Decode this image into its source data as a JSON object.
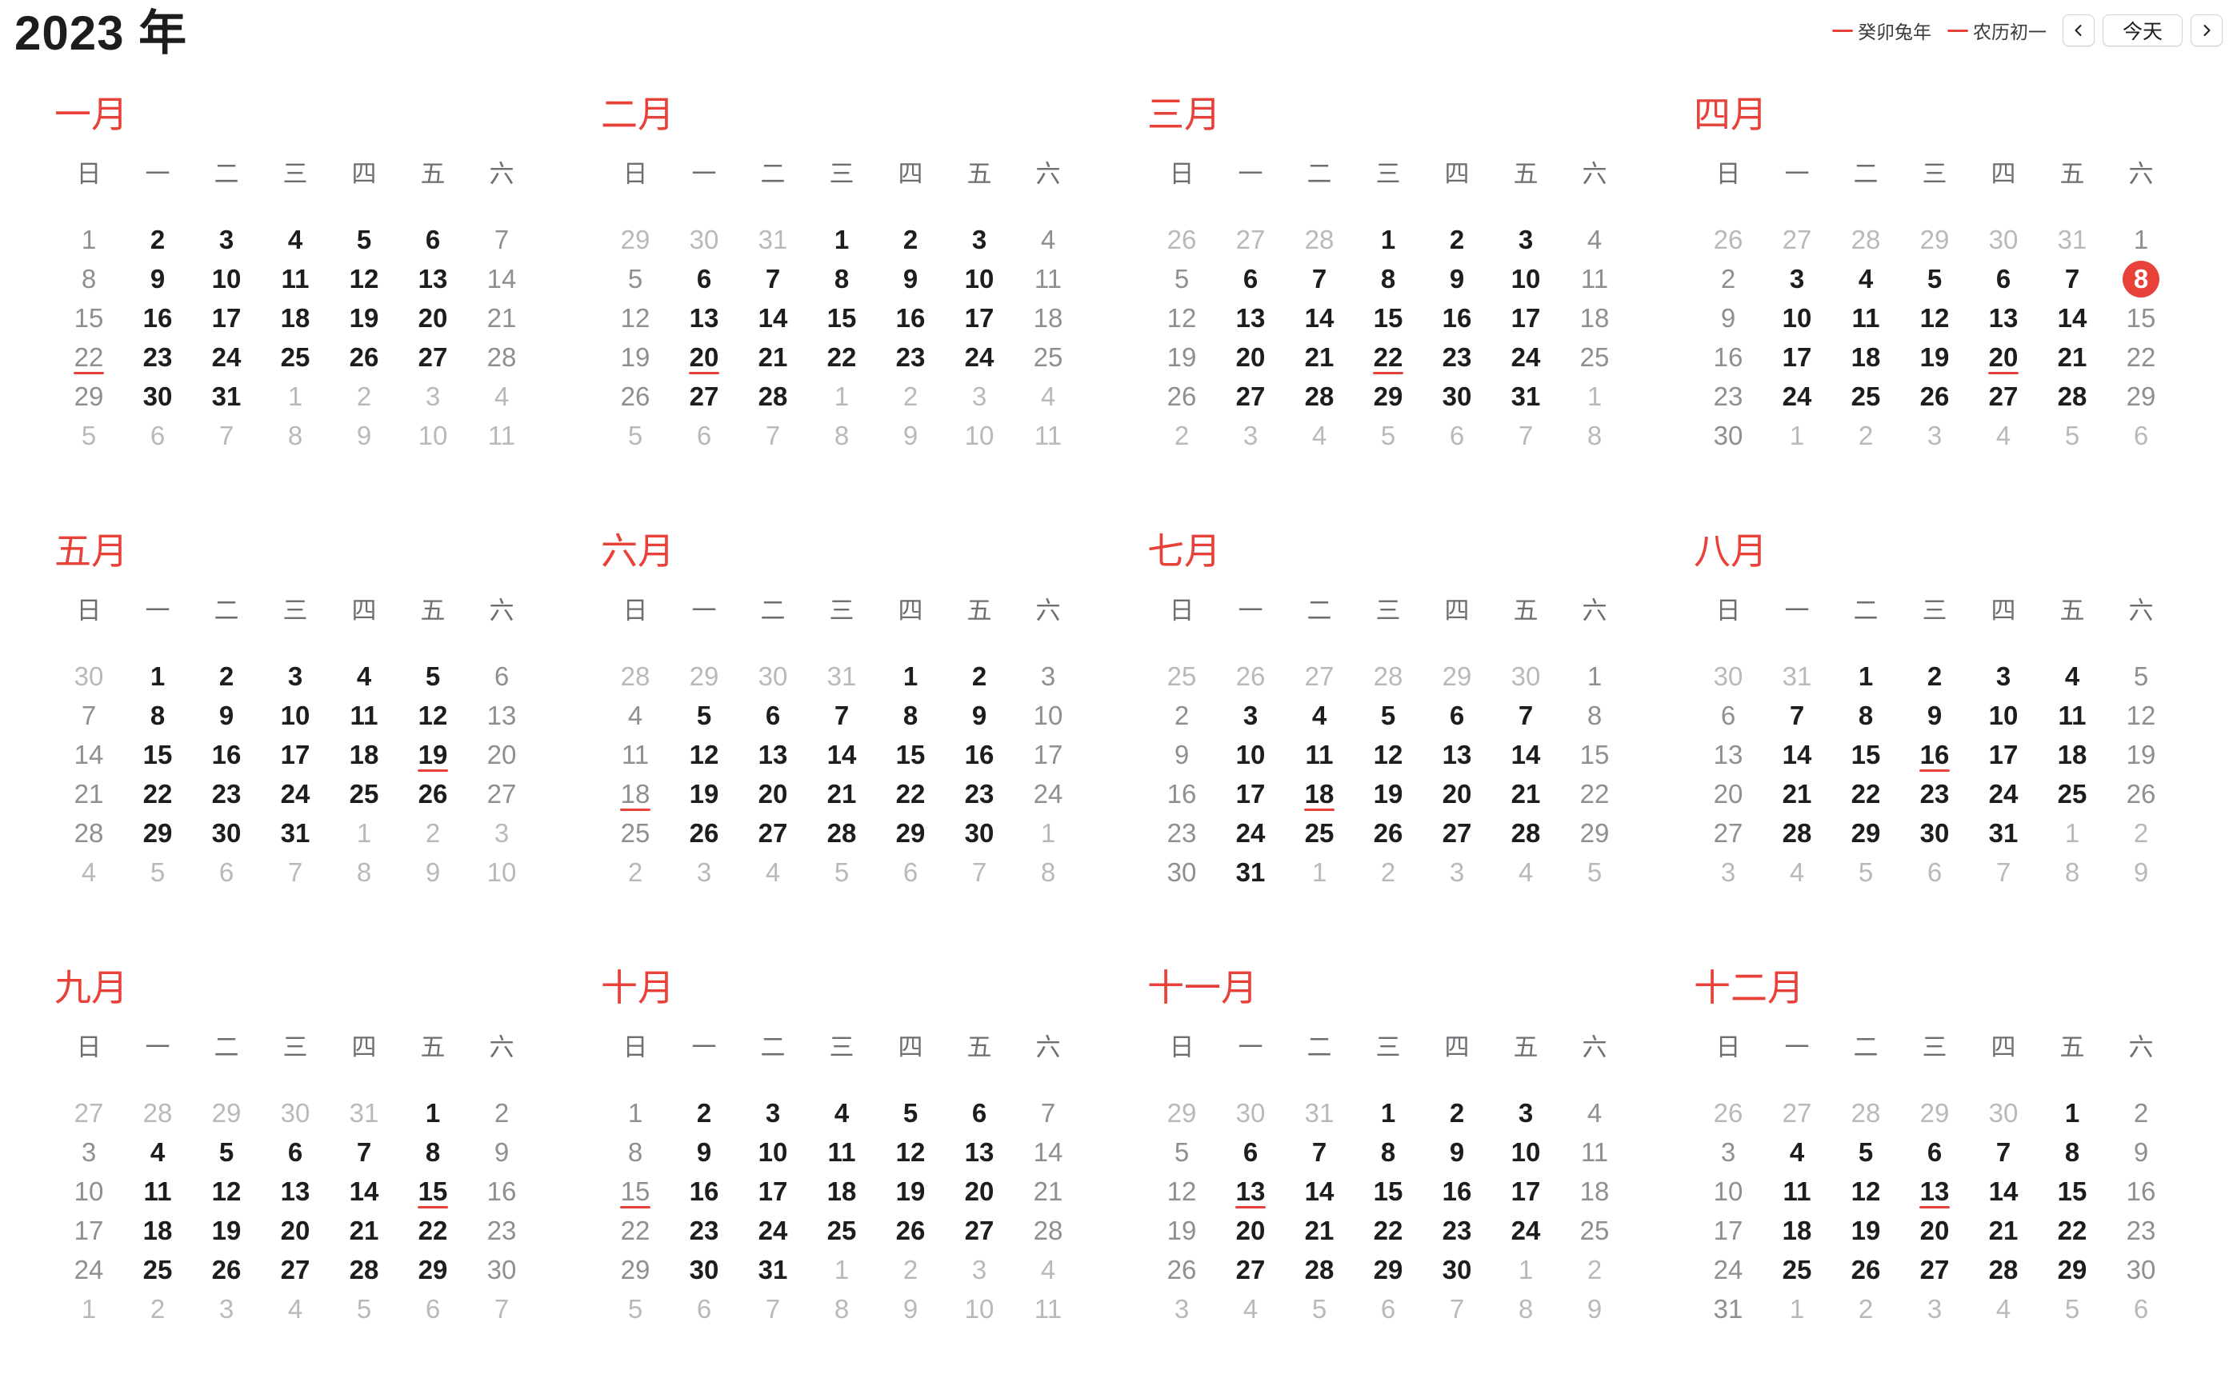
{
  "year_title": "2023 年",
  "legend": [
    {
      "label": "癸卯兔年",
      "color": "#e8413a"
    },
    {
      "label": "农历初一",
      "color": "#e8413a"
    }
  ],
  "nav": {
    "prev_icon": "chevron-left-icon",
    "today_label": "今天",
    "next_icon": "chevron-right-icon"
  },
  "weekdays": [
    "日",
    "一",
    "二",
    "三",
    "四",
    "五",
    "六"
  ],
  "today": {
    "month": 4,
    "day": 8
  },
  "accent_color": "#e8413a",
  "months": [
    {
      "name": "一月",
      "lead": [],
      "days": 31,
      "trail": [
        1,
        2,
        3,
        4,
        5,
        6,
        7,
        8,
        9,
        10,
        11
      ],
      "holidays": [
        22
      ]
    },
    {
      "name": "二月",
      "lead": [
        29,
        30,
        31
      ],
      "days": 28,
      "trail": [
        1,
        2,
        3,
        4,
        5,
        6,
        7,
        8,
        9,
        10,
        11
      ],
      "holidays": [
        20
      ]
    },
    {
      "name": "三月",
      "lead": [
        26,
        27,
        28
      ],
      "days": 31,
      "trail": [
        1,
        2,
        3,
        4,
        5,
        6,
        7,
        8
      ],
      "holidays": [
        22
      ]
    },
    {
      "name": "四月",
      "lead": [
        26,
        27,
        28,
        29,
        30,
        31
      ],
      "days": 30,
      "trail": [
        1,
        2,
        3,
        4,
        5,
        6
      ],
      "holidays": [
        20
      ]
    },
    {
      "name": "五月",
      "lead": [
        30
      ],
      "days": 31,
      "trail": [
        1,
        2,
        3,
        4,
        5,
        6,
        7,
        8,
        9,
        10
      ],
      "holidays": [
        19
      ]
    },
    {
      "name": "六月",
      "lead": [
        28,
        29,
        30,
        31
      ],
      "days": 30,
      "trail": [
        1,
        2,
        3,
        4,
        5,
        6,
        7,
        8
      ],
      "holidays": [
        18
      ]
    },
    {
      "name": "七月",
      "lead": [
        25,
        26,
        27,
        28,
        29,
        30
      ],
      "days": 31,
      "trail": [
        1,
        2,
        3,
        4,
        5
      ],
      "holidays": [
        18
      ]
    },
    {
      "name": "八月",
      "lead": [
        30,
        31
      ],
      "days": 31,
      "trail": [
        1,
        2,
        3,
        4,
        5,
        6,
        7,
        8,
        9
      ],
      "holidays": [
        16
      ]
    },
    {
      "name": "九月",
      "lead": [
        27,
        28,
        29,
        30,
        31
      ],
      "days": 30,
      "trail": [
        1,
        2,
        3,
        4,
        5,
        6,
        7
      ],
      "holidays": [
        15
      ]
    },
    {
      "name": "十月",
      "lead": [],
      "days": 31,
      "trail": [
        1,
        2,
        3,
        4,
        5,
        6,
        7,
        8,
        9,
        10,
        11
      ],
      "holidays": [
        15
      ]
    },
    {
      "name": "十一月",
      "lead": [
        29,
        30,
        31
      ],
      "days": 30,
      "trail": [
        1,
        2,
        3,
        4,
        5,
        6,
        7,
        8,
        9
      ],
      "holidays": [
        13
      ]
    },
    {
      "name": "十二月",
      "lead": [
        26,
        27,
        28,
        29,
        30
      ],
      "days": 31,
      "trail": [
        1,
        2,
        3,
        4,
        5,
        6
      ],
      "holidays": [
        13
      ]
    }
  ]
}
